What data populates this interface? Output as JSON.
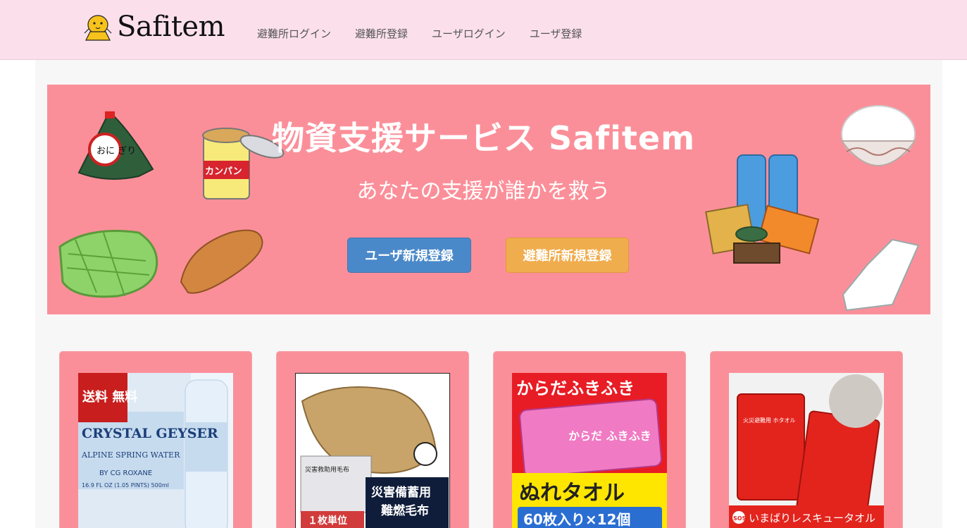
{
  "header": {
    "brand": "Safitem",
    "nav": [
      {
        "label": "避難所ログイン"
      },
      {
        "label": "避難所登録"
      },
      {
        "label": "ユーザログイン"
      },
      {
        "label": "ユーザ登録"
      }
    ]
  },
  "hero": {
    "title": "物資支援サービス Safitem",
    "subtitle": "あなたの支援が誰かを救う",
    "user_signup_button": "ユーザ新規登録",
    "shelter_signup_button": "避難所新規登録",
    "illustrations": {
      "onigiri": "おに ぎり",
      "kanpan": "カンパン"
    }
  },
  "products": [
    {
      "badge": "送料 無料",
      "brand_text": "CRYSTAL GEYSER",
      "sub_text": "ALPINE SPRING WATER",
      "by_text": "BY CG ROXANE",
      "volume_text": "16.9 FL OZ (1.05 PINTS) 500ml"
    },
    {
      "tag": "災害救助用毛布",
      "banner_line1": "災害備蓄用",
      "banner_line2": "難燃毛布",
      "unit": "１枚単位"
    },
    {
      "top_text": "からだふきふき",
      "package_text": "からだ ふきふき",
      "bottom_text": "ぬれタオル",
      "count_text": "60枚入り×12個"
    },
    {
      "package_text": "火災避難用 ホタオル",
      "caption": "いまばりレスキュータオル",
      "sos": "SOS"
    }
  ]
}
